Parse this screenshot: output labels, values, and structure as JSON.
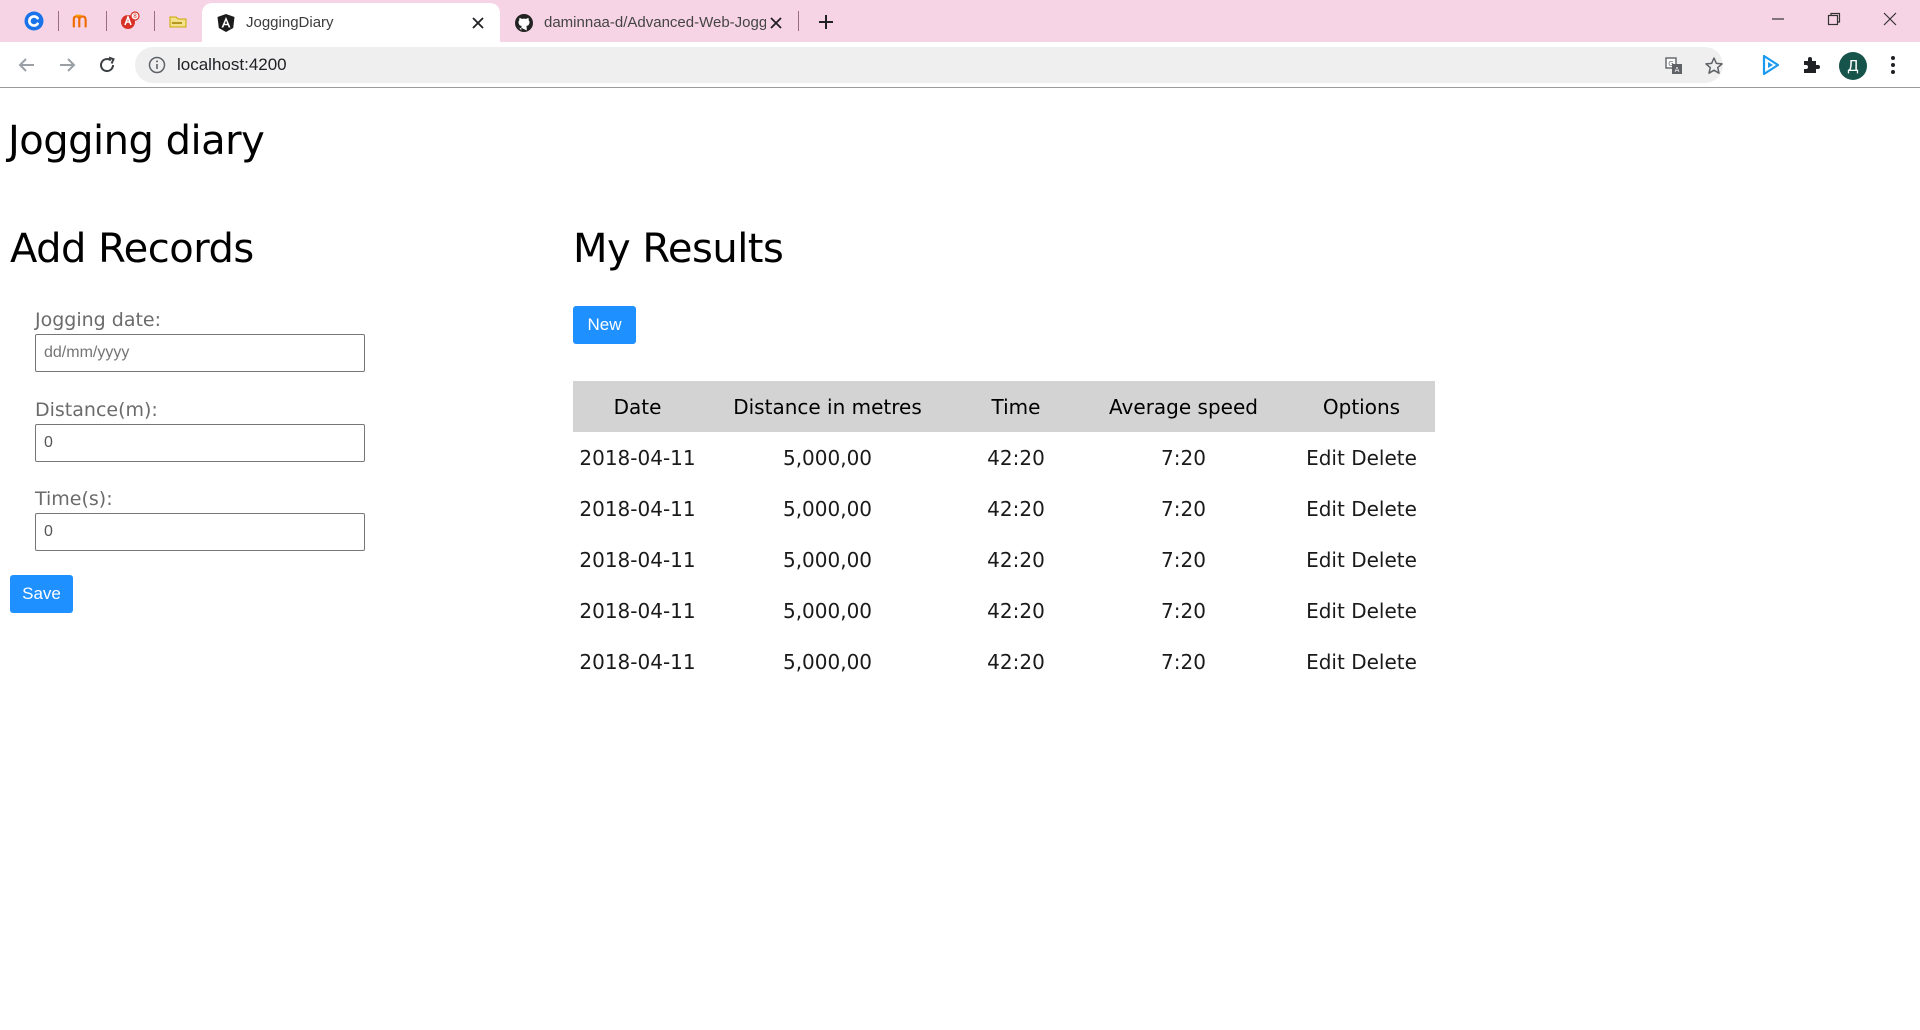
{
  "browser": {
    "tabs": [
      {
        "title": "JoggingDiary",
        "active": true
      },
      {
        "title": "daminnaa-d/Advanced-Web-Jogging-Diary",
        "active": false
      }
    ],
    "address_bar": {
      "url": "localhost:4200"
    },
    "profile_initial": "Д",
    "colors": {
      "tabstrip": "#f7d4e5",
      "profile": "#16534a"
    }
  },
  "page": {
    "title": "Jogging diary",
    "add_records": {
      "heading": "Add Records",
      "fields": {
        "date": {
          "label": "Jogging date:",
          "placeholder": "dd/mm/yyyy",
          "value": ""
        },
        "distance": {
          "label": "Distance(m):",
          "value": "0"
        },
        "time": {
          "label": "Time(s):",
          "value": "0"
        }
      },
      "save_label": "Save"
    },
    "results": {
      "heading": "My Results",
      "new_label": "New",
      "columns": [
        "Date",
        "Distance in metres",
        "Time",
        "Average speed",
        "Options"
      ],
      "rows": [
        {
          "date": "2018-04-11",
          "distance": "5,000,00",
          "time": "42:20",
          "speed": "7:20",
          "edit": "Edit",
          "delete": "Delete"
        },
        {
          "date": "2018-04-11",
          "distance": "5,000,00",
          "time": "42:20",
          "speed": "7:20",
          "edit": "Edit",
          "delete": "Delete"
        },
        {
          "date": "2018-04-11",
          "distance": "5,000,00",
          "time": "42:20",
          "speed": "7:20",
          "edit": "Edit",
          "delete": "Delete"
        },
        {
          "date": "2018-04-11",
          "distance": "5,000,00",
          "time": "42:20",
          "speed": "7:20",
          "edit": "Edit",
          "delete": "Delete"
        },
        {
          "date": "2018-04-11",
          "distance": "5,000,00",
          "time": "42:20",
          "speed": "7:20",
          "edit": "Edit",
          "delete": "Delete"
        }
      ]
    },
    "colors": {
      "button": "#1e90ff",
      "table_header": "#d3d3d3"
    }
  }
}
